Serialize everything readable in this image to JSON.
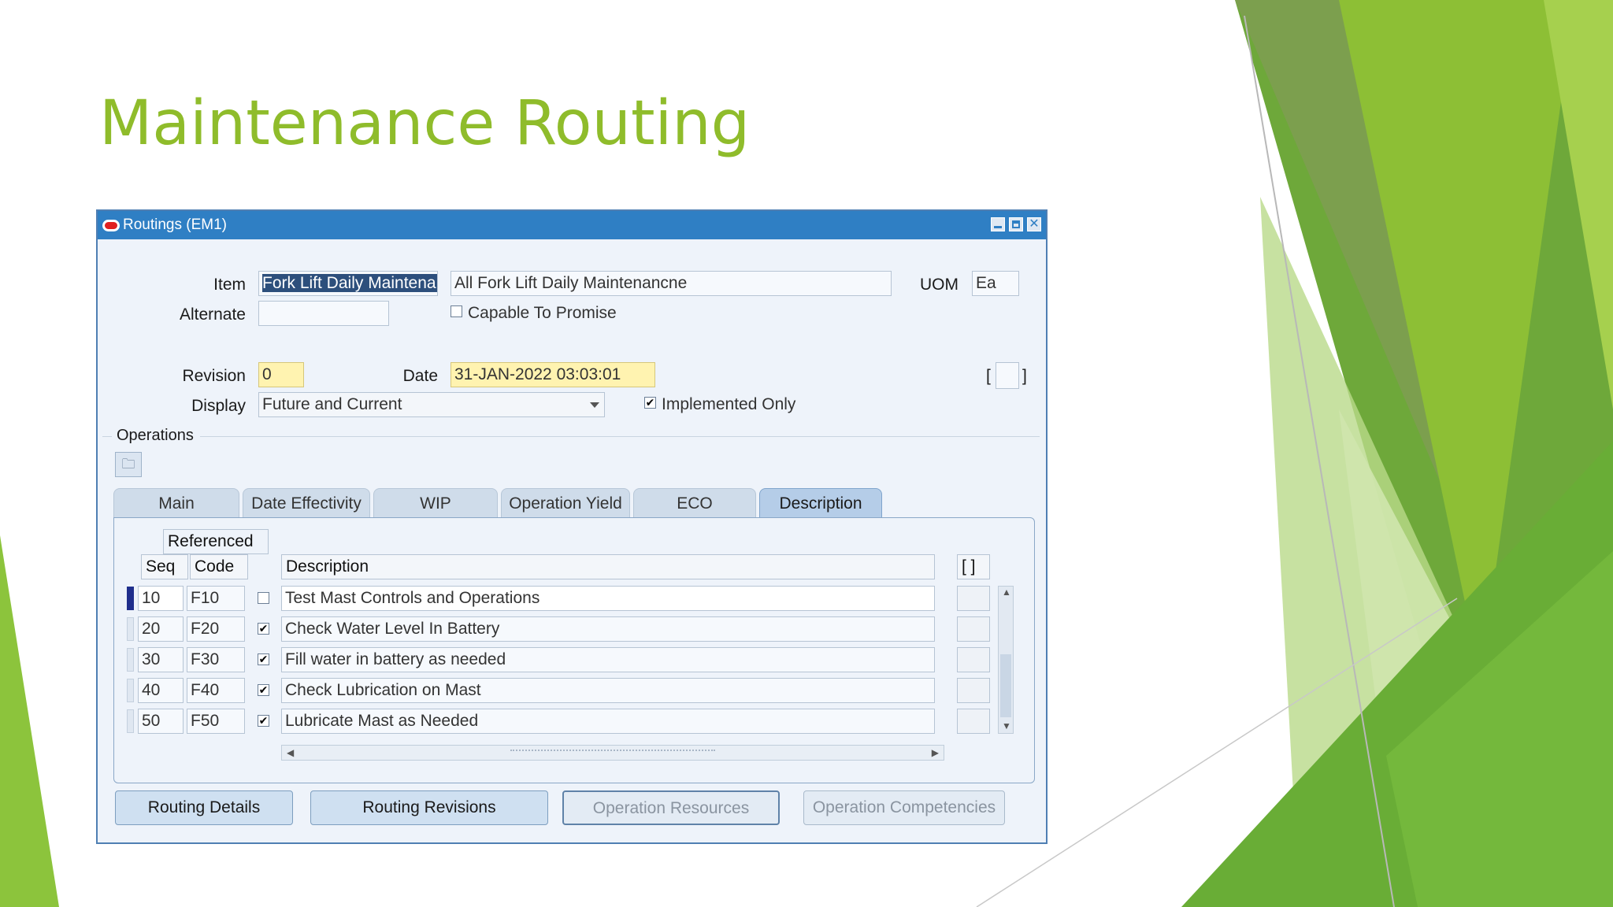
{
  "slide": {
    "title": "Maintenance Routing"
  },
  "window": {
    "title": "Routings (EM1)"
  },
  "form": {
    "item_label": "Item",
    "item_value": "Fork Lift Daily Maintenar",
    "item_description": "All Fork Lift Daily Maintenancne",
    "uom_label": "UOM",
    "uom_value": "Ea",
    "alternate_label": "Alternate",
    "alternate_value": "",
    "capable_to_promise_label": "Capable To Promise",
    "capable_to_promise_checked": false,
    "revision_label": "Revision",
    "revision_value": "0",
    "date_label": "Date",
    "date_value": "31-JAN-2022 03:03:01",
    "display_label": "Display",
    "display_value": "Future and Current",
    "implemented_only_label": "Implemented Only",
    "implemented_only_checked": true,
    "bracket_left": "[",
    "bracket_right": "]"
  },
  "operations": {
    "section_label": "Operations",
    "tabs": [
      "Main",
      "Date Effectivity",
      "WIP",
      "Operation Yield",
      "ECO",
      "Description"
    ],
    "active_tab": "Description",
    "headers": {
      "referenced": "Referenced",
      "seq": "Seq",
      "code": "Code",
      "description": "Description",
      "flex": "[ ]"
    },
    "rows": [
      {
        "seq": "10",
        "code": "F10",
        "referenced": false,
        "description": "Test Mast Controls and Operations"
      },
      {
        "seq": "20",
        "code": "F20",
        "referenced": true,
        "description": "Check Water Level In Battery"
      },
      {
        "seq": "30",
        "code": "F30",
        "referenced": true,
        "description": "Fill water in battery as needed"
      },
      {
        "seq": "40",
        "code": "F40",
        "referenced": true,
        "description": "Check Lubrication on Mast"
      },
      {
        "seq": "50",
        "code": "F50",
        "referenced": true,
        "description": "Lubricate Mast as Needed"
      }
    ]
  },
  "buttons": {
    "routing_details": "Routing Details",
    "routing_revisions": "Routing Revisions",
    "operation_resources": "Operation Resources",
    "operation_competencies": "Operation Competencies"
  },
  "colors": {
    "title_green": "#8fbc2b",
    "titlebar_blue": "#2f7fc4",
    "deco_green": "#7fb72f"
  }
}
